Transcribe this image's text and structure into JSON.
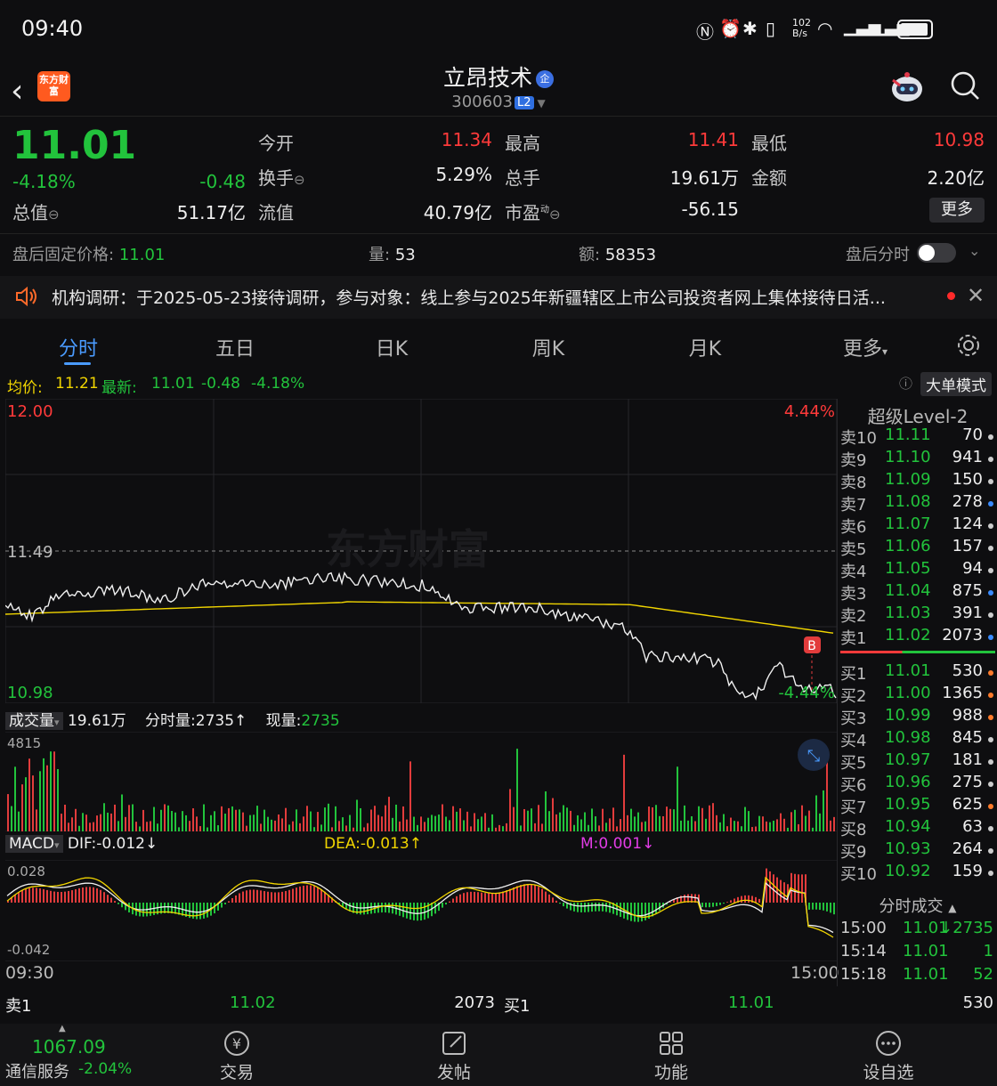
{
  "status_bar": {
    "time": "09:40",
    "net_speed": "102 B/s"
  },
  "header": {
    "logo_text": "东方财富",
    "name": "立昂技术",
    "name_badge": "企",
    "code": "300603",
    "level_badge": "L2"
  },
  "quote": {
    "price": "11.01",
    "change_pct": "-4.18%",
    "change_amt": "-0.48",
    "open_label": "今开",
    "open": "11.34",
    "high_label": "最高",
    "high": "11.41",
    "low_label": "最低",
    "low": "10.98",
    "turnover_label": "换手",
    "turnover": "5.29%",
    "volume_label": "总手",
    "volume": "19.61万",
    "amount_label": "金额",
    "amount": "2.20亿",
    "mktcap_label": "总值",
    "mktcap": "51.17亿",
    "float_label": "流值",
    "float_cap": "40.79亿",
    "pe_label": "市盈",
    "pe_sup": "动",
    "pe": "-56.15",
    "more_label": "更多"
  },
  "after_hours": {
    "price_label": "盘后固定价格:",
    "price": "11.01",
    "qty_label": "量:",
    "qty": "53",
    "amt_label": "额:",
    "amt": "58353",
    "tick_label": "盘后分时"
  },
  "news": {
    "text": "机构调研：于2025-05-23接待调研，参与对象：线上参与2025年新疆辖区上市公司投资者网上集体接待日活..."
  },
  "tabs": [
    {
      "label": "分时"
    },
    {
      "label": "五日"
    },
    {
      "label": "日K"
    },
    {
      "label": "周K"
    },
    {
      "label": "月K"
    },
    {
      "label": "更多"
    }
  ],
  "info_bar": {
    "avg_label": "均价:",
    "avg": "11.21",
    "latest_label": "最新:",
    "latest": "11.01",
    "chg": "-0.48",
    "pct": "-4.18%",
    "mode_label": "大单模式"
  },
  "main_chart": {
    "y_top": "12.00",
    "y_mid": "11.49",
    "y_bottom": "10.98",
    "pct_top": "4.44%",
    "pct_bottom": "-4.44%",
    "marker": "B",
    "watermark": "东方财富"
  },
  "volume": {
    "label": "成交量",
    "total": "19.61万",
    "tick_label": "分时量:",
    "tick": "2735",
    "tick_arrow": "↑",
    "now_label": "现量:",
    "now": "2735",
    "max": "4815"
  },
  "macd": {
    "label": "MACD",
    "dif": "DIF:-0.012↓",
    "dea": "DEA:-0.013↑",
    "m": "M:0.001↓",
    "y_top": "0.028",
    "y_bottom": "-0.042"
  },
  "time_axis": {
    "start": "09:30",
    "end": "15:00"
  },
  "order_book": {
    "title": "超级Level-2",
    "asks": [
      {
        "label": "卖10",
        "price": "11.11",
        "vol": "70",
        "dot": "#cccccc"
      },
      {
        "label": "卖9",
        "price": "11.10",
        "vol": "941",
        "dot": "#cccccc"
      },
      {
        "label": "卖8",
        "price": "11.09",
        "vol": "150",
        "dot": "#cccccc"
      },
      {
        "label": "卖7",
        "price": "11.08",
        "vol": "278",
        "dot": "#3a8bff"
      },
      {
        "label": "卖6",
        "price": "11.07",
        "vol": "124",
        "dot": "#cccccc"
      },
      {
        "label": "卖5",
        "price": "11.06",
        "vol": "157",
        "dot": "#cccccc"
      },
      {
        "label": "卖4",
        "price": "11.05",
        "vol": "94",
        "dot": "#cccccc"
      },
      {
        "label": "卖3",
        "price": "11.04",
        "vol": "875",
        "dot": "#3a8bff"
      },
      {
        "label": "卖2",
        "price": "11.03",
        "vol": "391",
        "dot": "#cccccc"
      },
      {
        "label": "卖1",
        "price": "11.02",
        "vol": "2073",
        "dot": "#3a8bff"
      }
    ],
    "bids": [
      {
        "label": "买1",
        "price": "11.01",
        "vol": "530",
        "dot": "#ff7a2a"
      },
      {
        "label": "买2",
        "price": "11.00",
        "vol": "1365",
        "dot": "#ff7a2a"
      },
      {
        "label": "买3",
        "price": "10.99",
        "vol": "988",
        "dot": "#ff7a2a"
      },
      {
        "label": "买4",
        "price": "10.98",
        "vol": "845",
        "dot": "#cccccc"
      },
      {
        "label": "买5",
        "price": "10.97",
        "vol": "181",
        "dot": "#cccccc"
      },
      {
        "label": "买6",
        "price": "10.96",
        "vol": "275",
        "dot": "#cccccc"
      },
      {
        "label": "买7",
        "price": "10.95",
        "vol": "625",
        "dot": "#ff7a2a"
      },
      {
        "label": "买8",
        "price": "10.94",
        "vol": "63",
        "dot": "#cccccc"
      },
      {
        "label": "买9",
        "price": "10.93",
        "vol": "264",
        "dot": "#cccccc"
      },
      {
        "label": "买10",
        "price": "10.92",
        "vol": "159",
        "dot": "#cccccc"
      }
    ],
    "ticks_title": "分时成交",
    "ticks": [
      {
        "time": "15:00",
        "price": "11.01",
        "vol": "↓2735"
      },
      {
        "time": "15:14",
        "price": "11.01",
        "vol": "1"
      },
      {
        "time": "15:18",
        "price": "11.01",
        "vol": "52"
      }
    ]
  },
  "best_bar": {
    "ask_label": "卖1",
    "ask_price": "11.02",
    "ask_vol": "2073",
    "bid_label": "买1",
    "bid_price": "11.01",
    "bid_vol": "530"
  },
  "bottom_nav": {
    "index_value": "1067.09",
    "index_name": "通信服务",
    "index_pct": "-2.04%",
    "items": [
      {
        "label": "交易"
      },
      {
        "label": "发帖"
      },
      {
        "label": "功能"
      },
      {
        "label": "设自选"
      }
    ]
  },
  "colors": {
    "up": "#ff3a3a",
    "down": "#22c33c",
    "avg_line": "#f1d500",
    "accent": "#4a9bff"
  }
}
